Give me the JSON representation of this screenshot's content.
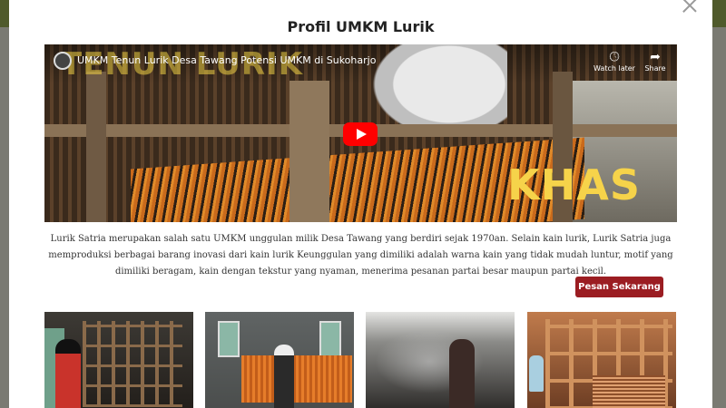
{
  "modal": {
    "title": "Profil UMKM Lurik",
    "close_icon": "close-icon"
  },
  "video": {
    "title": "UMKM Tenun Lurik Desa Tawang Potensi UMKM di Sukoharjo",
    "overlay_title": "TENUN LURIK",
    "overlay_word": "KHAS",
    "watch_later_label": "Watch later",
    "share_label": "Share",
    "watch_later_icon": "clock-icon",
    "share_icon": "share-icon",
    "play_icon": "play-icon",
    "play_color": "#ff0000"
  },
  "description": "Lurik Satria merupakan salah satu UMKM unggulan milik Desa Tawang yang berdiri sejak 1970an. Selain kain lurik, Lurik Satria juga memproduksi berbagai barang inovasi dari kain lurik Keunggulan yang dimiliki adalah warna kain yang tidak mudah luntur, motif yang dimiliki beragam, kain dengan tekstur yang nyaman, menerima pesanan partai besar maupun partai kecil.",
  "order_button": {
    "label": "Pesan Sekarang >>",
    "color": "#9b1d22"
  },
  "gallery": [
    {
      "name": "gallery-photo-weaver-woman"
    },
    {
      "name": "gallery-photo-dyed-yarn"
    },
    {
      "name": "gallery-photo-smoky-workshop"
    },
    {
      "name": "gallery-photo-loom-frame"
    }
  ]
}
